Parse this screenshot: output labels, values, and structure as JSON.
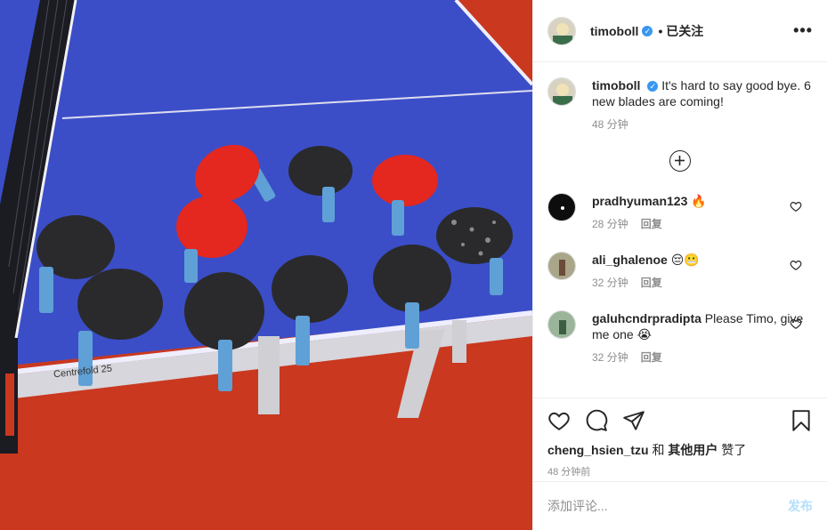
{
  "post": {
    "username": "timoboll",
    "follow_state": "已关注",
    "more_label": "•••",
    "caption": "It's hard to say good bye. 6 new blades are coming!",
    "caption_time": "48 分钟"
  },
  "comments": [
    {
      "username": "pradhyuman123",
      "text": "🔥",
      "time": "28 分钟",
      "reply": "回复"
    },
    {
      "username": "ali_ghalenoe",
      "text": "😔😬",
      "time": "32 分钟",
      "reply": "回复"
    },
    {
      "username": "galuhcndrpradipta",
      "text": "Please Timo, give me one 😭",
      "time": "32 分钟",
      "reply": "回复"
    }
  ],
  "likes": {
    "user": "cheng_hsien_tzu",
    "and": "和",
    "others": "其他用户",
    "liked": "赞了"
  },
  "post_time": "48 分钟前",
  "add_comment": {
    "placeholder": "添加评论...",
    "post_label": "发布"
  },
  "photo_text": {
    "table_brand": "Centrefold 25"
  },
  "colors": {
    "accent": "#3897f0",
    "table_blue": "#3b4ec8",
    "floor_red": "#c8361d"
  },
  "icons": [
    "heart-icon",
    "comment-icon",
    "share-icon",
    "bookmark-icon",
    "plus-circle-icon",
    "verified-icon",
    "more-icon"
  ]
}
